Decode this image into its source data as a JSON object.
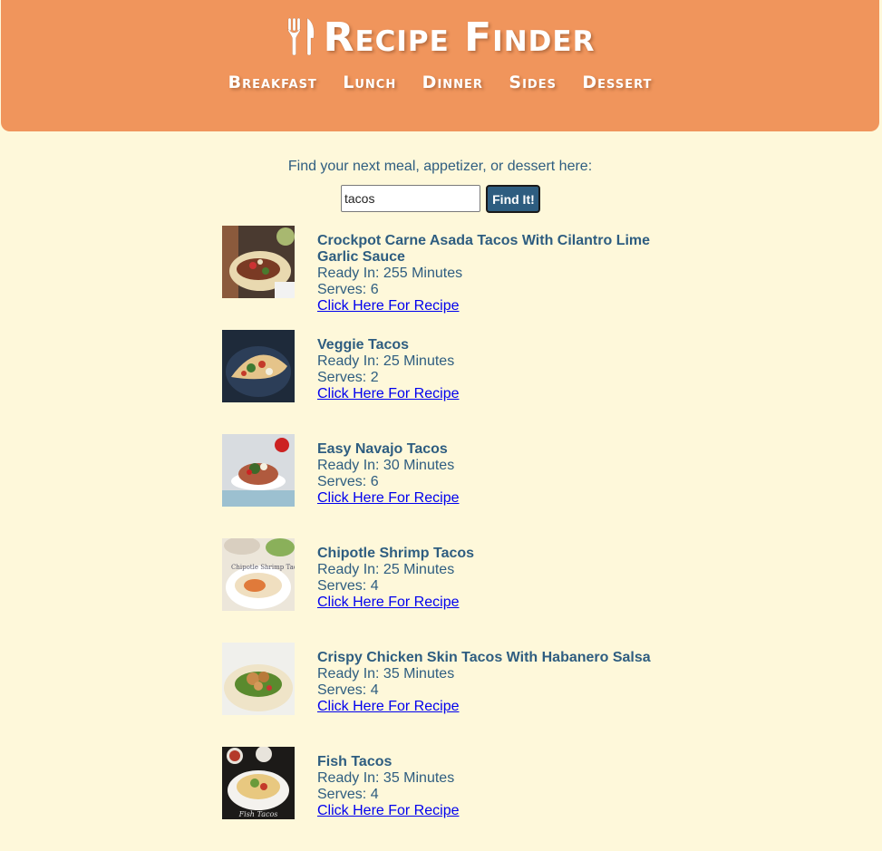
{
  "header": {
    "title": "Recipe Finder",
    "nav": [
      "Breakfast",
      "Lunch",
      "Dinner",
      "Sides",
      "Dessert"
    ]
  },
  "search": {
    "prompt": "Find your next meal, appetizer, or dessert here:",
    "value": "tacos",
    "button_label": "Find It!"
  },
  "results": [
    {
      "title": "Crockpot Carne Asada Tacos With Cilantro Lime Garlic Sauce",
      "ready": "Ready In: 255 Minutes",
      "serves": "Serves: 6",
      "link": "Click Here For Recipe"
    },
    {
      "title": "Veggie Tacos",
      "ready": "Ready In: 25 Minutes",
      "serves": "Serves: 2",
      "link": "Click Here For Recipe"
    },
    {
      "title": "Easy Navajo Tacos",
      "ready": "Ready In: 30 Minutes",
      "serves": "Serves: 6",
      "link": "Click Here For Recipe"
    },
    {
      "title": "Chipotle Shrimp Tacos",
      "ready": "Ready In: 25 Minutes",
      "serves": "Serves: 4",
      "link": "Click Here For Recipe"
    },
    {
      "title": "Crispy Chicken Skin Tacos With Habanero Salsa",
      "ready": "Ready In: 35 Minutes",
      "serves": "Serves: 4",
      "link": "Click Here For Recipe"
    },
    {
      "title": "Fish Tacos",
      "ready": "Ready In: 35 Minutes",
      "serves": "Serves: 4",
      "link": "Click Here For Recipe"
    }
  ],
  "colors": {
    "header_bg": "#f0955c",
    "page_bg": "#fef8da",
    "text": "#2e5d80",
    "button_bg": "#2e5d80",
    "link": "#0000ee"
  }
}
